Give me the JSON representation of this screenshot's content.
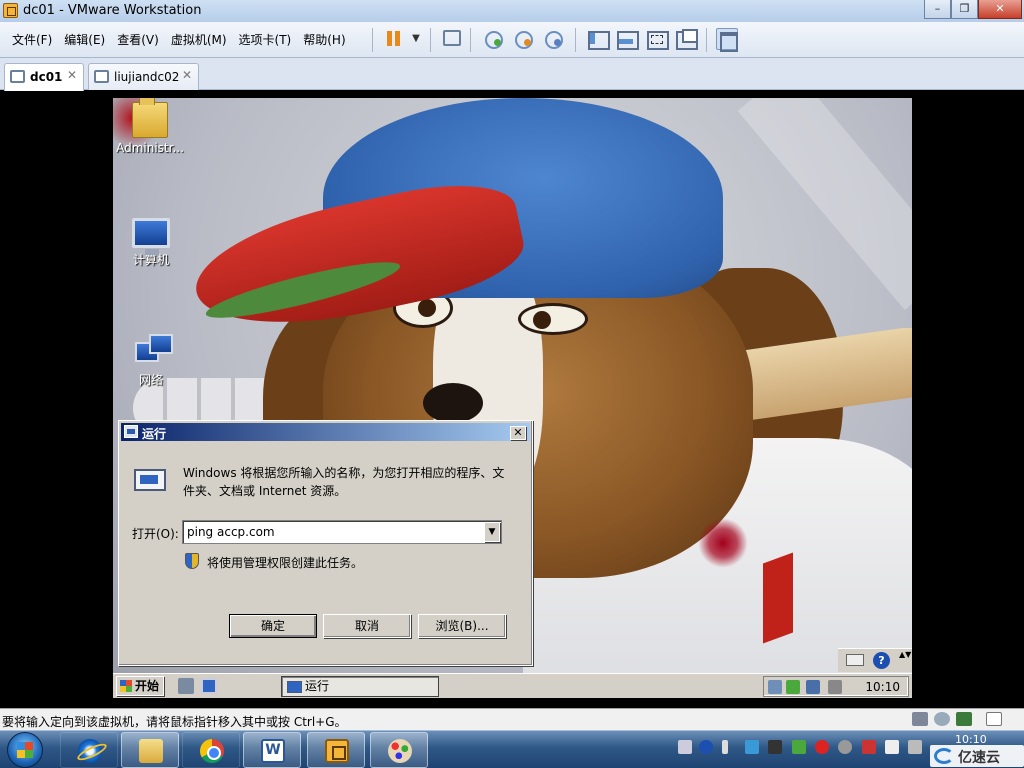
{
  "window": {
    "title": "dc01 - VMware Workstation",
    "minimize": "–",
    "restore": "❐",
    "close": "✕"
  },
  "menu": [
    "文件(F)",
    "编辑(E)",
    "查看(V)",
    "虚拟机(M)",
    "选项卡(T)",
    "帮助(H)"
  ],
  "toolbar": {
    "dropdown": "▼"
  },
  "tabs": [
    {
      "label": "dc01",
      "close": "✕"
    },
    {
      "label": "liujiandc02",
      "close": "✕"
    }
  ],
  "desktop_icons": [
    {
      "label": "Administr...",
      "icon": "folder-icon"
    },
    {
      "label": "计算机",
      "icon": "computer-icon"
    },
    {
      "label": "网络",
      "icon": "network-icon"
    }
  ],
  "run_dialog": {
    "title": "运行",
    "close": "✕",
    "description": "Windows 将根据您所输入的名称，为您打开相应的程序、文件夹、文档或 Internet 资源。",
    "open_label": "打开(O):",
    "open_value": "ping accp.com",
    "dropdown": "▼",
    "admin_note": "将使用管理权限创建此任务。",
    "ok": "确定",
    "cancel": "取消",
    "browse": "浏览(B)..."
  },
  "guest_taskbar": {
    "start": "开始",
    "task": "运行",
    "clock": "10:10",
    "help": "?",
    "arrows": "▲▼"
  },
  "statusbar": {
    "message": "要将输入定向到该虚拟机，请将鼠标指针移入其中或按 Ctrl+G。"
  },
  "host_taskbar": {
    "clock": "10:10",
    "brand": "亿速云",
    "apps": [
      "explorer-icon",
      "chrome-icon",
      "word-icon",
      "vmware-icon",
      "paint-icon"
    ]
  },
  "colors": {
    "titlebar": "#b6cde9",
    "accent_pause": "#e88a1a",
    "dialog_title": "#0a246a",
    "guest_face": "#d4d0c8"
  }
}
